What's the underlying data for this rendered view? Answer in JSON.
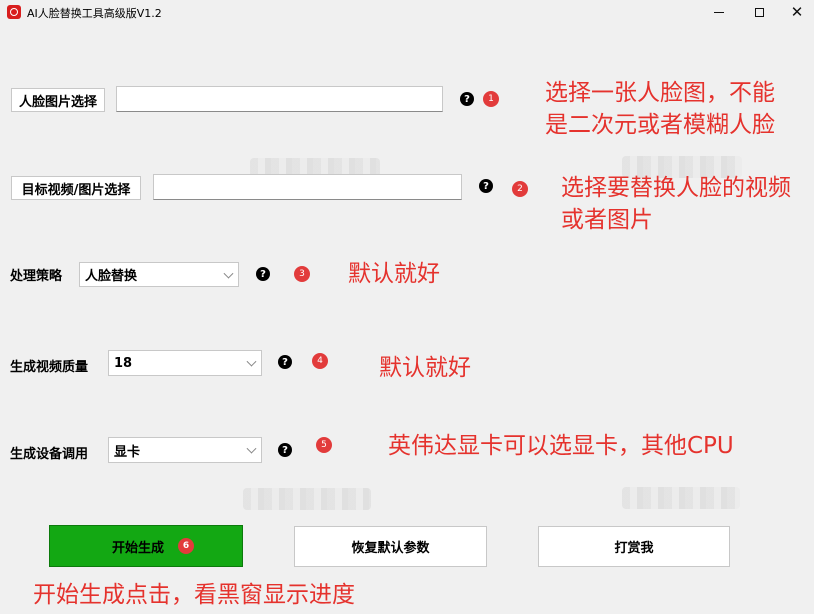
{
  "window": {
    "title": "AI人脸替换工具高级版V1.2",
    "minimize": "",
    "maximize": "",
    "close": "✕"
  },
  "face_select": {
    "button_label": "人脸图片选择",
    "value": "",
    "help": "?",
    "badge": "1",
    "note_line1": "选择一张人脸图，不能",
    "note_line2": "是二次元或者模糊人脸"
  },
  "target_select": {
    "button_label": "目标视频/图片选择",
    "value": "",
    "help": "?",
    "badge": "2",
    "note_line1": "选择要替换人脸的视频",
    "note_line2": "或者图片"
  },
  "strategy": {
    "label": "处理策略",
    "selected": "人脸替换",
    "help": "?",
    "badge": "3",
    "note": "默认就好"
  },
  "quality": {
    "label": "生成视频质量",
    "selected": "18",
    "help": "?",
    "badge": "4",
    "note": "默认就好"
  },
  "device": {
    "label": "生成设备调用",
    "selected": "显卡",
    "help": "?",
    "badge": "5",
    "note": "英伟达显卡可以选显卡，其他CPU"
  },
  "actions": {
    "start_label": "开始生成",
    "start_badge": "6",
    "reset_label": "恢复默认参数",
    "donate_label": "打赏我",
    "start_note": "开始生成点击，看黑窗显示进度"
  },
  "colors": {
    "background": "#f0f0f0",
    "accent_red": "#e5322d",
    "start_green": "#13a813"
  }
}
